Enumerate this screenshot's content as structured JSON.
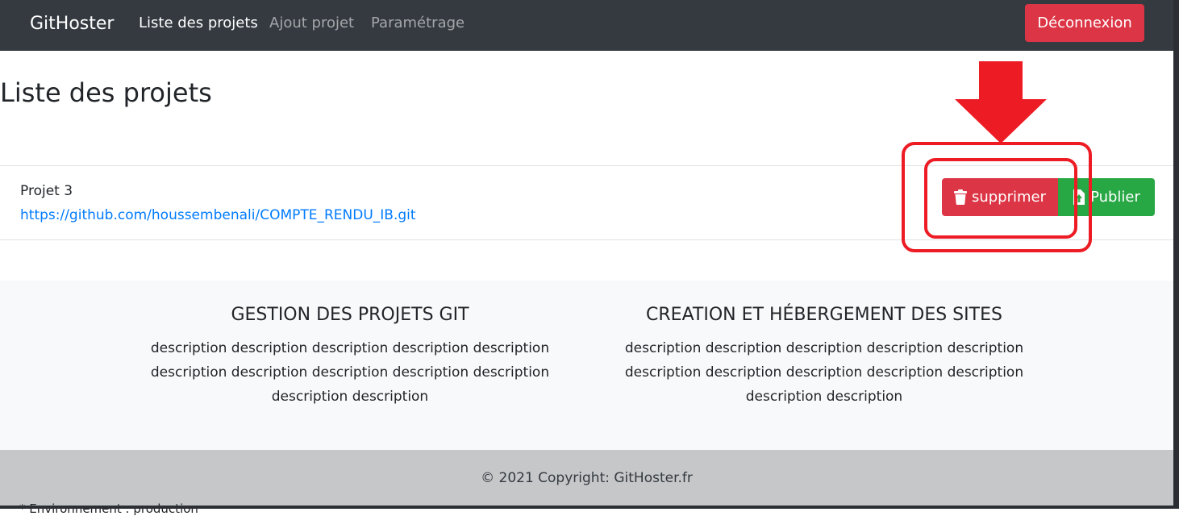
{
  "navbar": {
    "brand": "GitHoster",
    "items": [
      {
        "label": "Liste des projets",
        "active": true
      },
      {
        "label": "Ajout projet",
        "active": false
      },
      {
        "label": "Paramétrage",
        "active": false
      }
    ],
    "logout_label": "Déconnexion"
  },
  "page": {
    "title": "Liste des projets"
  },
  "projects": [
    {
      "name": "Projet 3",
      "url": "https://github.com/houssembenali/COMPTE_RENDU_IB.git",
      "delete_label": "supprimer",
      "delete_icon": "trash-icon",
      "publish_label": "Publier",
      "publish_icon": "upload-icon"
    }
  ],
  "features": [
    {
      "title": "GESTION DES PROJETS GIT",
      "lines": [
        "description description description description description",
        "description description description description description",
        "description description"
      ]
    },
    {
      "title": "CREATION ET HÉBERGEMENT DES SITES",
      "lines": [
        "description description description description description",
        "description description description description description",
        "description description"
      ]
    }
  ],
  "footer": {
    "copyright": "© 2021 Copyright: GitHoster.fr",
    "env": "* Environnement : production"
  },
  "colors": {
    "navbar": "#343a40",
    "danger": "#dc3545",
    "success": "#28a745",
    "link": "#007bff",
    "annotation": "#ed1c24"
  }
}
